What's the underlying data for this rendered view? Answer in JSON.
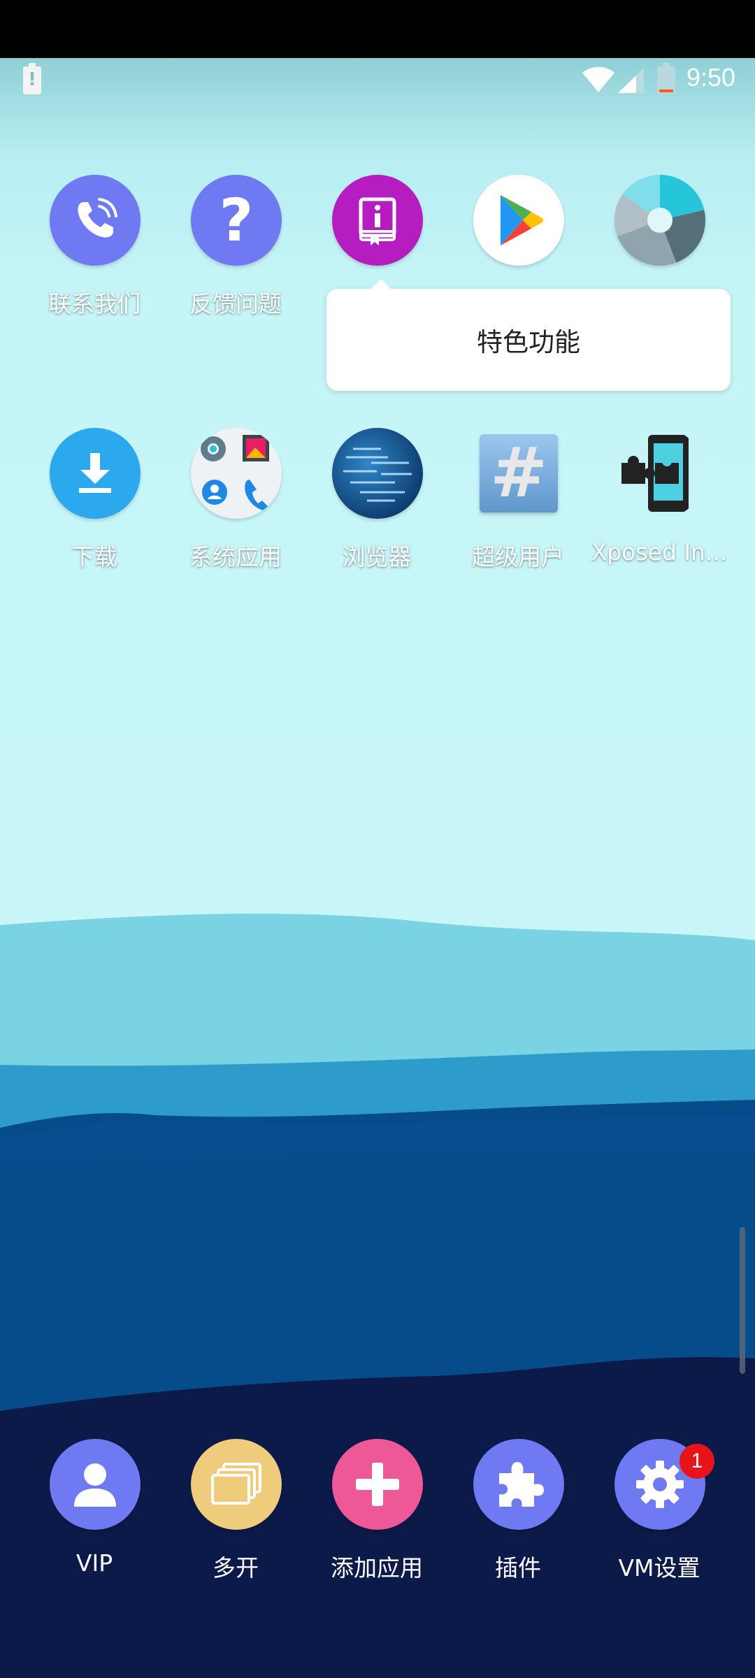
{
  "status_bar": {
    "time": "9:50",
    "alert_glyph": "!",
    "icons": [
      "battery-alert-icon",
      "wifi-icon",
      "cell-signal-icon",
      "battery-low-icon"
    ]
  },
  "apps_row1": [
    {
      "label": "联系我们",
      "icon": "phone-icon",
      "color": "#6e79f2"
    },
    {
      "label": "反馈问题",
      "icon": "question-icon",
      "color": "#6e79f2"
    },
    {
      "label": "",
      "icon": "book-info-icon",
      "color": "#b61dc0"
    },
    {
      "label": "",
      "icon": "play-store-icon",
      "color": "#ffffff"
    },
    {
      "label": "",
      "icon": "camera-shutter-icon",
      "color": "#cfd8dc"
    }
  ],
  "apps_row2": [
    {
      "label": "下载",
      "icon": "download-icon",
      "color": "#2ba8ee"
    },
    {
      "label": "系统应用",
      "icon": "system-apps-icon",
      "color": "#eef2f4"
    },
    {
      "label": "浏览器",
      "icon": "globe-icon",
      "color": "#1c5d99"
    },
    {
      "label": "超级用户",
      "icon": "hash-icon",
      "color": "#7fb2de"
    },
    {
      "label": "Xposed In...",
      "icon": "puzzle-phone-icon",
      "color": "#1d1d1d"
    }
  ],
  "popup": {
    "item": "特色功能"
  },
  "dock": [
    {
      "label": "VIP",
      "icon": "user-icon",
      "color": "#6e79f2"
    },
    {
      "label": "多开",
      "icon": "stacked-windows-icon",
      "color": "#efcb7c"
    },
    {
      "label": "添加应用",
      "icon": "plus-icon",
      "color": "#ee5896"
    },
    {
      "label": "插件",
      "icon": "puzzle-icon",
      "color": "#6e79f2"
    },
    {
      "label": "VM设置",
      "icon": "gear-icon",
      "color": "#6e79f2",
      "badge": "1"
    }
  ]
}
